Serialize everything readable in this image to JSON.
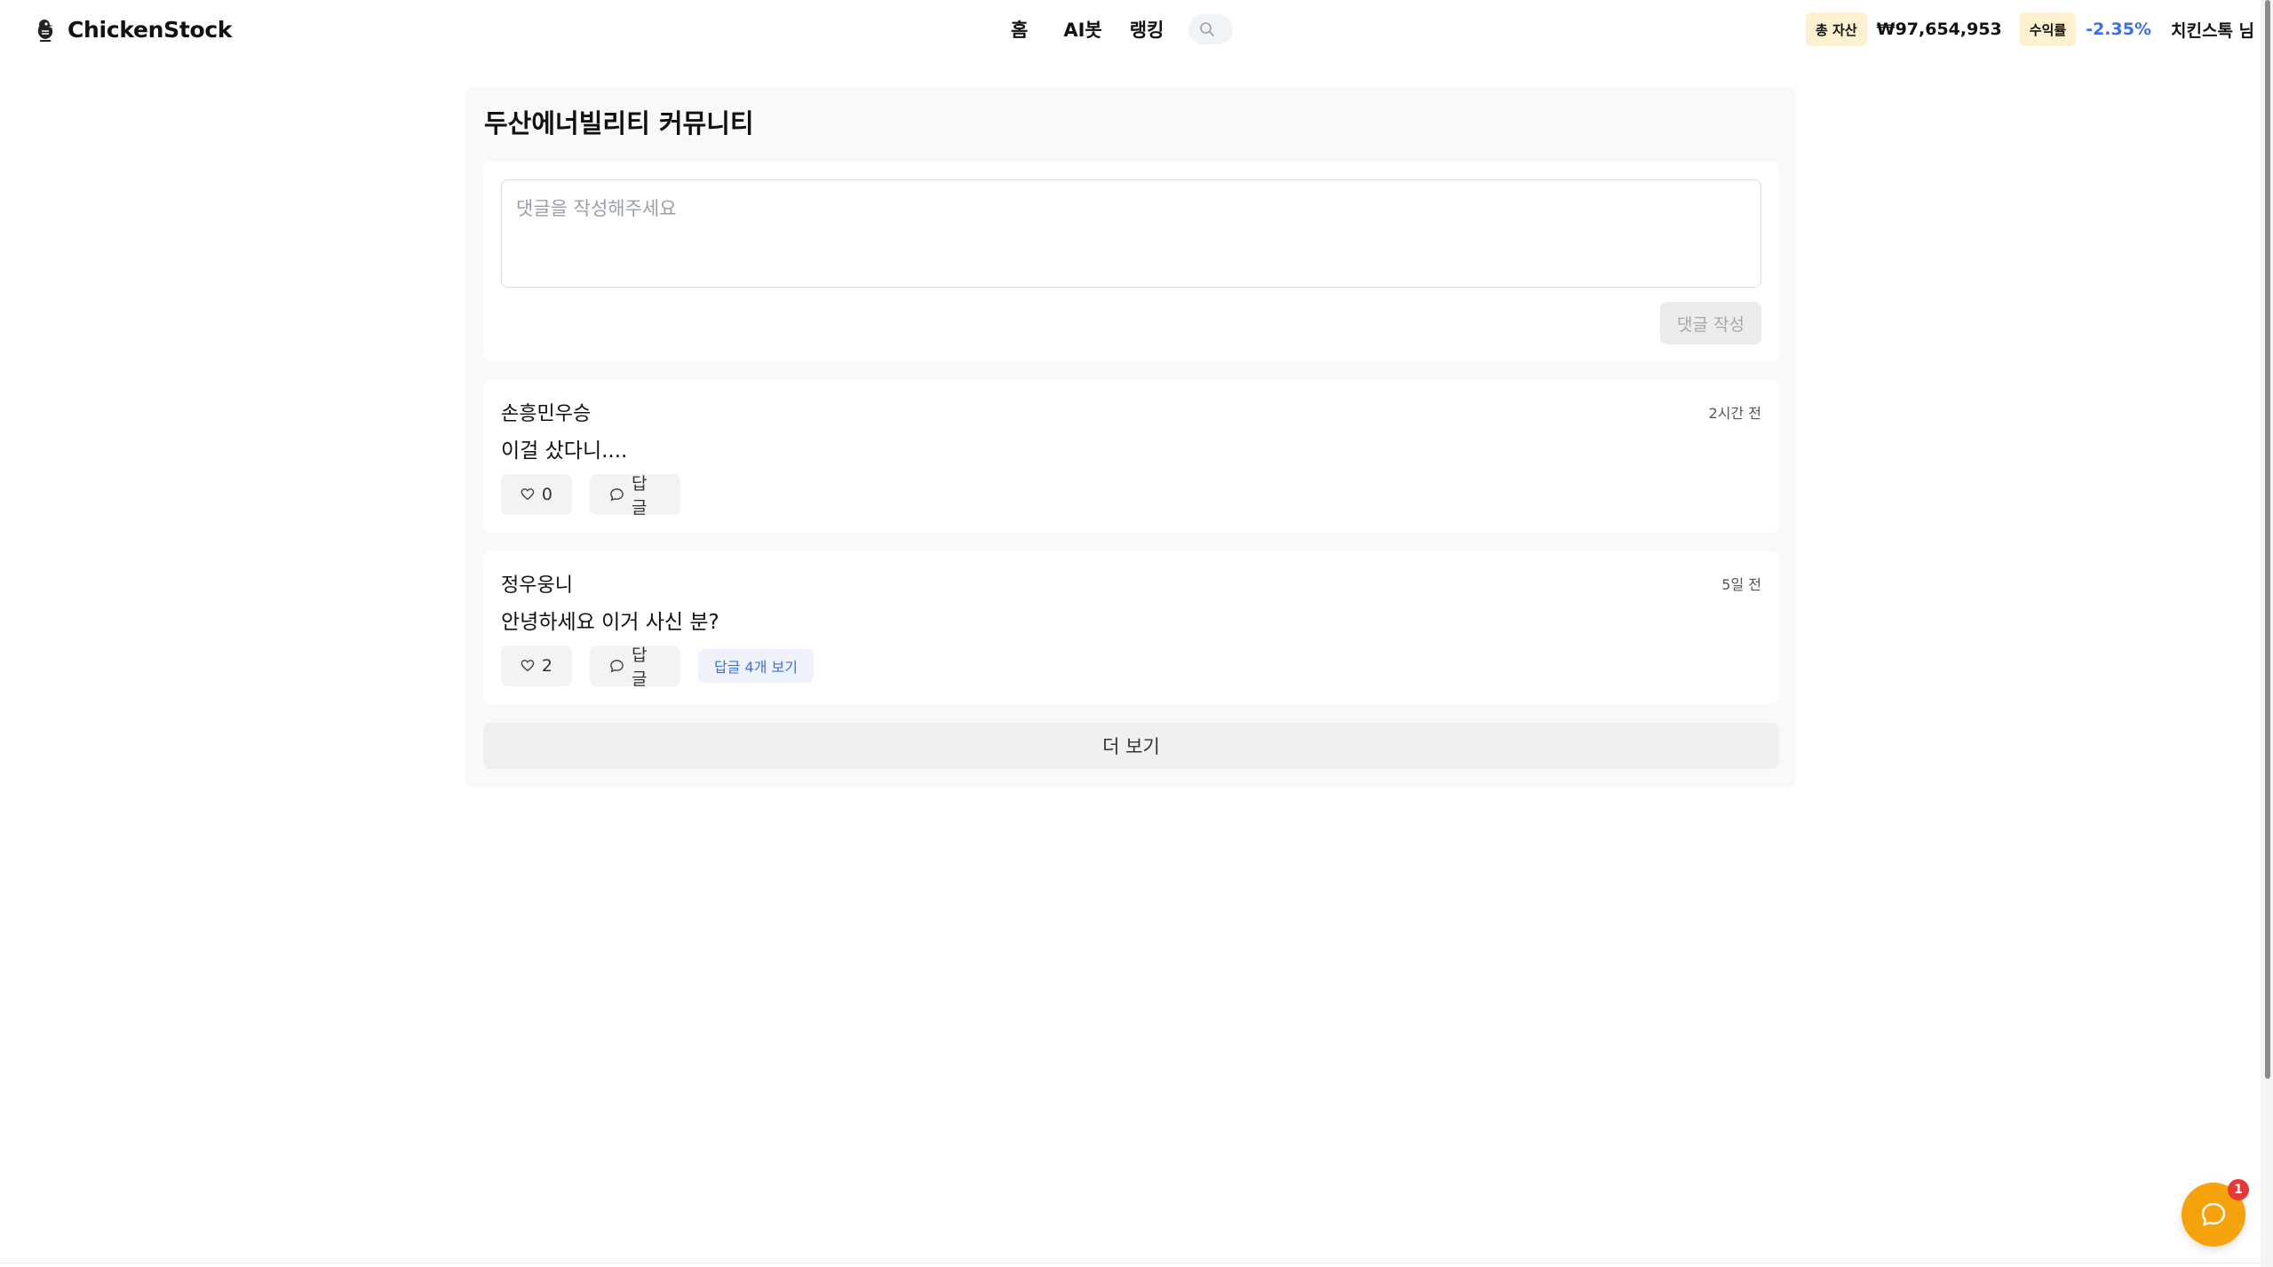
{
  "header": {
    "brand": "ChickenStock",
    "nav": {
      "home": "홈",
      "ai_bot": "AI봇",
      "ranking": "랭킹"
    },
    "search_icon": "search-icon",
    "total_assets_label": "총 자산",
    "total_assets_value": "₩97,654,953",
    "return_label": "수익률",
    "return_value": "-2.35%",
    "user_name": "치킨스톡 님"
  },
  "community": {
    "title": "두산에너빌리티 커뮤니티",
    "input_placeholder": "댓글을 작성해주세요",
    "submit_label": "댓글 작성",
    "comments": [
      {
        "author": "손흥민우승",
        "time": "2시간 전",
        "text": "이걸 샀다니....",
        "likes": "0",
        "reply_label": "답글"
      },
      {
        "author": "정우웅니",
        "time": "5일 전",
        "text": "안녕하세요 이거 사신 분?",
        "likes": "2",
        "reply_label": "답글",
        "view_replies": "답글 4개 보기"
      }
    ],
    "more_label": "더 보기"
  },
  "chat": {
    "icon": "chat-bubble-icon",
    "badge_count": "1"
  },
  "colors": {
    "badge_bg": "#fdf1cf",
    "return_negative": "#3b6fe8",
    "chat_fab": "#f5a20b",
    "notification": "#e53935"
  }
}
